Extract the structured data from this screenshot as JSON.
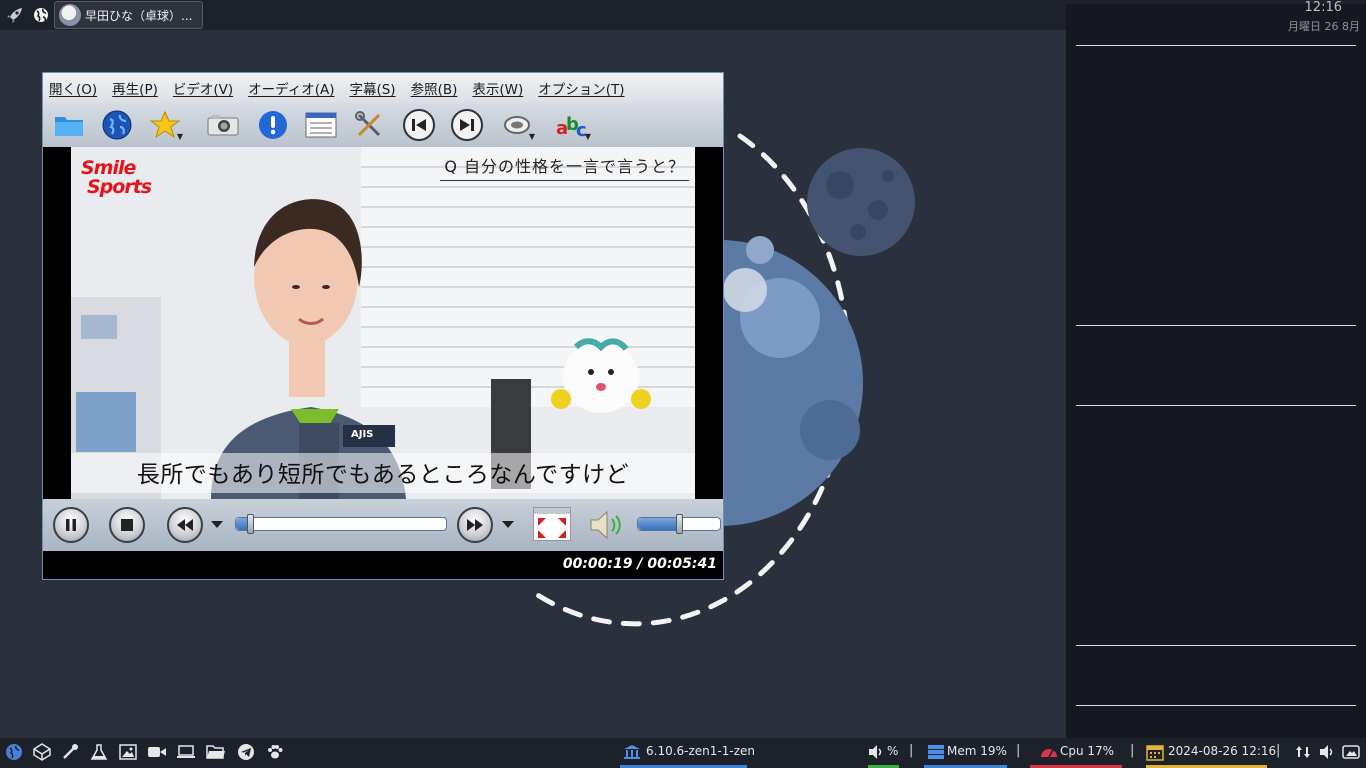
{
  "top_panel": {
    "window_title": "早田ひな（卓球）..."
  },
  "side_panel": {
    "time": "12:16",
    "date": "月曜日 26 8月"
  },
  "player": {
    "menu": [
      "開く(O)",
      "再生(P)",
      "ビデオ(V)",
      "オーディオ(A)",
      "字幕(S)",
      "参照(B)",
      "表示(W)",
      "オプション(T)"
    ],
    "toolbar_icons": [
      "open-folder-icon",
      "open-url-globe-icon",
      "favorites-star-icon",
      "screenshot-camera-icon",
      "info-icon",
      "playlist-icon",
      "preferences-tools-icon",
      "previous-track-icon",
      "next-track-icon",
      "audio-track-icon",
      "subtitle-abc-icon"
    ],
    "video": {
      "logo_line1": "Smile",
      "logo_line2": "Sports",
      "question": "Q 自分の性格を一言で言うと？",
      "subtitle": "長所でもあり短所でもあるところなんですけど",
      "jacket_text": "AJIS"
    },
    "seek_fraction": 0.056,
    "volume_fraction": 0.5,
    "timecode": "00:00:19 / 00:05:41"
  },
  "bottom_panel": {
    "launchers": [
      "browser-globe-icon",
      "codepen-cube-icon",
      "color-picker-icon",
      "lab-flask-icon",
      "image-viewer-icon",
      "video-camera-icon",
      "laptop-icon",
      "file-manager-folder-icon",
      "telegram-icon",
      "paw-icon"
    ],
    "kernel": "6.10.6-zen1-1-zen",
    "volume": "%",
    "mem": "Mem 19%",
    "cpu": "Cpu  17%",
    "datetime": "2024-08-26 12:16",
    "sep": "|",
    "colors": {
      "kernel_bar": "#3b82d8",
      "volume_bar": "#3cb043",
      "mem_bar": "#3b82d8",
      "cpu_bar": "#d8344a",
      "date_bar": "#e0b23a"
    }
  }
}
